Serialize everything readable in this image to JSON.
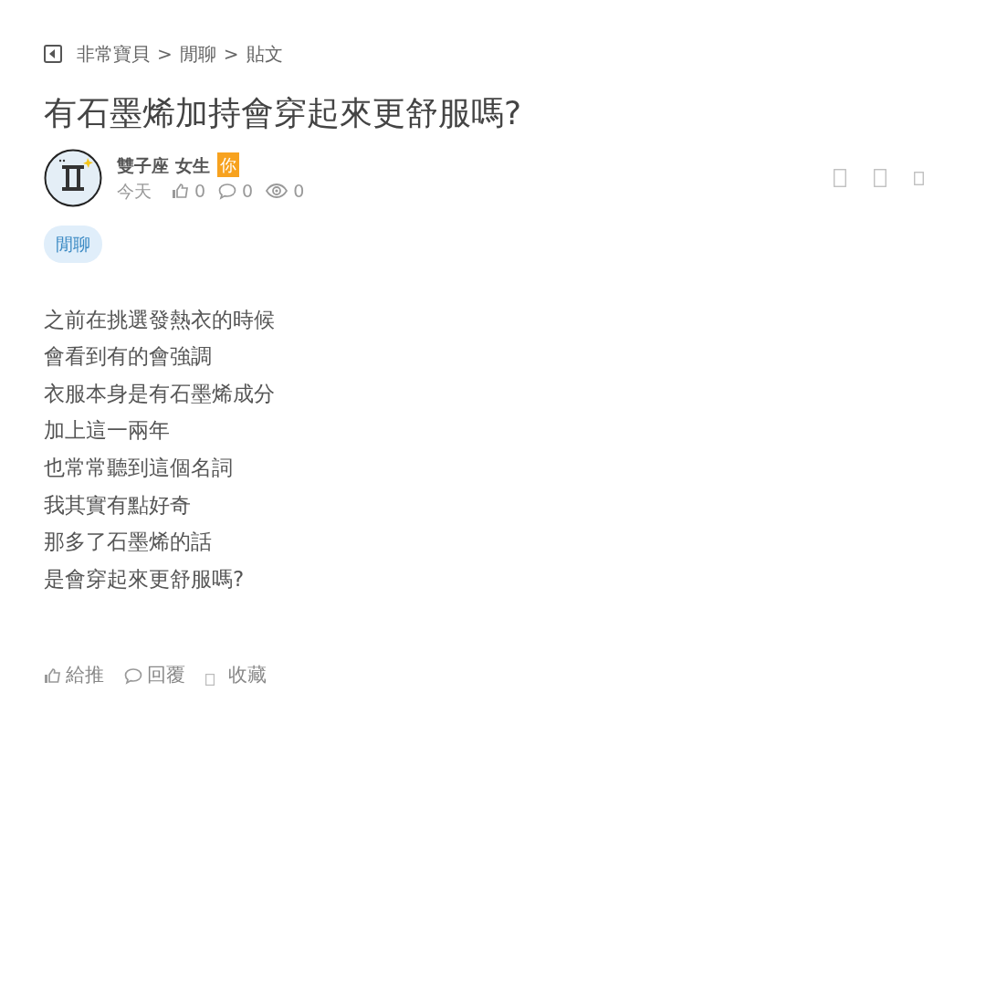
{
  "breadcrumb": [
    "非常寶貝",
    "閒聊",
    "貼文"
  ],
  "separator": ">",
  "title": "有石墨烯加持會穿起來更舒服嗎?",
  "author": {
    "name": "雙子座 女生",
    "badge": "你"
  },
  "meta": {
    "time": "今天",
    "likes": "0",
    "comments": "0",
    "views": "0"
  },
  "tag": "閒聊",
  "body": [
    "之前在挑選發熱衣的時候",
    "會看到有的會強調",
    "衣服本身是有石墨烯成分",
    "加上這一兩年",
    "也常常聽到這個名詞",
    "我其實有點好奇",
    "那多了石墨烯的話",
    "是會穿起來更舒服嗎?"
  ],
  "actions": [
    {
      "kind": "like",
      "label": "給推"
    },
    {
      "kind": "reply",
      "label": "回覆"
    },
    {
      "kind": "save",
      "label": "收藏"
    }
  ]
}
